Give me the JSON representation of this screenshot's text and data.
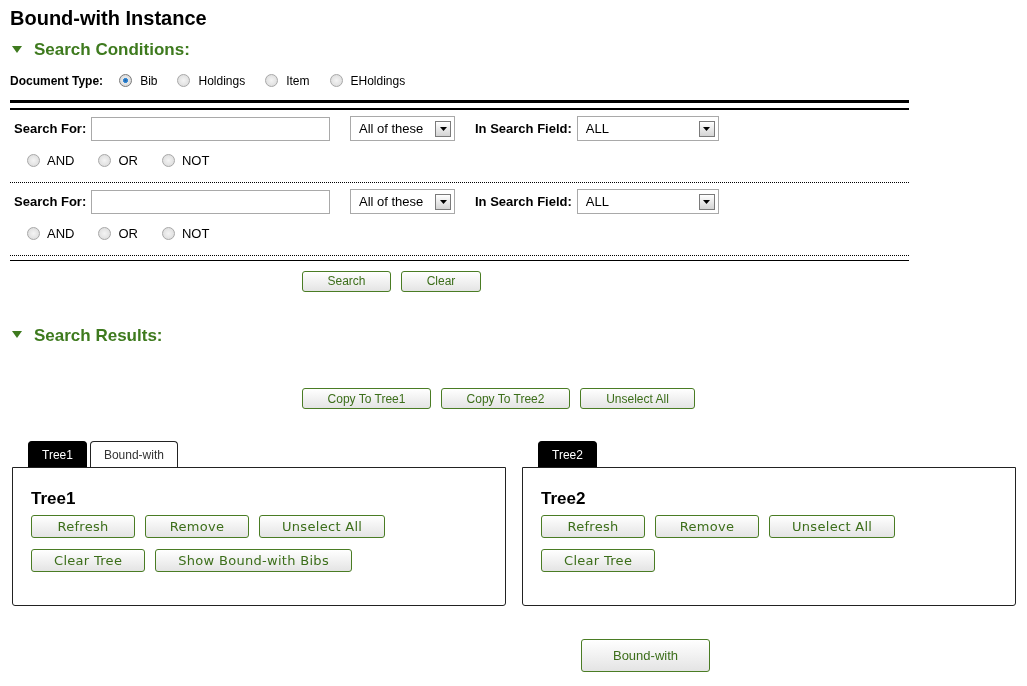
{
  "title": "Bound-with Instance",
  "search_conditions": {
    "heading": "Search Conditions:",
    "expanded": true,
    "document_type": {
      "label": "Document Type:",
      "options": [
        {
          "label": "Bib",
          "selected": true
        },
        {
          "label": "Holdings",
          "selected": false
        },
        {
          "label": "Item",
          "selected": false
        },
        {
          "label": "EHoldings",
          "selected": false
        }
      ]
    },
    "rows": [
      {
        "label": "Search For:",
        "match": "All of these",
        "field_label": "In Search Field:",
        "field": "ALL",
        "operators": [
          {
            "label": "AND",
            "selected": false
          },
          {
            "label": "OR",
            "selected": false
          },
          {
            "label": "NOT",
            "selected": false
          }
        ]
      },
      {
        "label": "Search For:",
        "match": "All of these",
        "field_label": "In Search Field:",
        "field": "ALL",
        "operators": [
          {
            "label": "AND",
            "selected": false
          },
          {
            "label": "OR",
            "selected": false
          },
          {
            "label": "NOT",
            "selected": false
          }
        ]
      }
    ],
    "buttons": [
      "Search",
      "Clear"
    ]
  },
  "search_results": {
    "heading": "Search Results:",
    "expanded": true,
    "buttons": [
      "Copy To Tree1",
      "Copy To Tree2",
      "Unselect All"
    ]
  },
  "trees": [
    {
      "tabs": [
        {
          "label": "Tree1",
          "selected": true
        },
        {
          "label": "Bound-with",
          "selected": false
        }
      ],
      "title": "Tree1",
      "button_rows": [
        [
          "Refresh",
          "Remove",
          "Unselect All"
        ],
        [
          "Clear Tree",
          "Show Bound-with Bibs"
        ]
      ]
    },
    {
      "tabs": [
        {
          "label": "Tree2",
          "selected": true
        }
      ],
      "title": "Tree2",
      "button_rows": [
        [
          "Refresh",
          "Remove",
          "Unselect All"
        ],
        [
          "Clear Tree"
        ]
      ]
    }
  ],
  "bound_with_button": "Bound-with"
}
